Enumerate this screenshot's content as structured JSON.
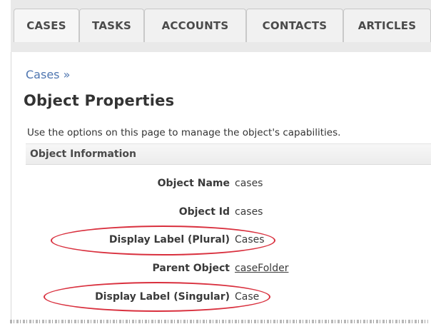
{
  "tabs": [
    {
      "label": "CASES"
    },
    {
      "label": "TASKS"
    },
    {
      "label": "ACCOUNTS"
    },
    {
      "label": "CONTACTS"
    },
    {
      "label": "ARTICLES"
    }
  ],
  "breadcrumb": "Cases »",
  "page_title": "Object Properties",
  "description": "Use the options on this page to manage the object's capabilities.",
  "section_title": "Object Information",
  "fields": [
    {
      "label": "Object Name",
      "value": "cases"
    },
    {
      "label": "Object Id",
      "value": "cases"
    },
    {
      "label": "Display Label (Plural)",
      "value": "Cases"
    },
    {
      "label": "Parent Object",
      "value": "caseFolder"
    },
    {
      "label": "Display Label (Singular)",
      "value": "Case"
    }
  ],
  "colors": {
    "highlight": "#d9303e",
    "link": "#4f76b0"
  }
}
